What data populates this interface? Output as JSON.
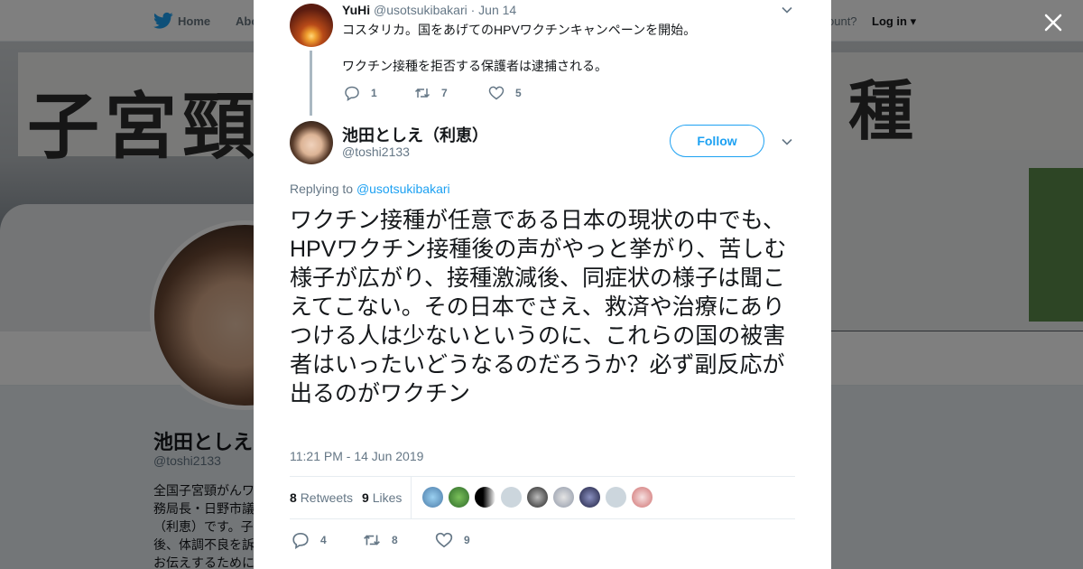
{
  "background": {
    "nav": {
      "home": "Home",
      "about": "Abo",
      "account_prompt": "ccount?",
      "login": "Log in"
    },
    "banner": {
      "sign_left": "子宮頸",
      "sign_right": "種"
    },
    "profile": {
      "name": "池田としえ",
      "handle": "@toshi2133",
      "bio": "全国子宮頸がんワ務局長・日野市議（利恵）です。子後、体調不良を訴お伝えするために"
    }
  },
  "modal": {
    "parent_tweet": {
      "name": "YuHi",
      "handle": "@usotsukibakari",
      "date": "· Jun 14",
      "line1": "コスタリカ。国をあげてのHPVワクチンキャンペーンを開始。",
      "line2": "ワクチン接種を拒否する保護者は逮捕される。",
      "replies": "1",
      "retweets": "7",
      "likes": "5"
    },
    "tweet": {
      "name": "池田としえ（利恵）",
      "handle": "@toshi2133",
      "follow_label": "Follow",
      "replying_prefix": "Replying to",
      "replying_to": "@usotsukibakari",
      "text": "ワクチン接種が任意である日本の現状の中でも、HPVワクチン接種後の声がやっと挙がり、苦しむ様子が広がり、接種激減後、同症状の様子は聞こえてこない。その日本でさえ、救済や治療にありつける人は少ないというのに、これらの国の被害者はいったいどうなるのだろうか？必ず副反応が出るのがワクチン",
      "timestamp": "11:21 PM - 14 Jun 2019",
      "retweet_count": "8",
      "retweet_label": "Retweets",
      "like_count": "9",
      "like_label": "Likes",
      "replies": "4",
      "retweets": "8",
      "likes": "9"
    }
  },
  "colors": {
    "accent": "#1da1f2",
    "muted": "#657786",
    "text": "#14171a"
  },
  "icons": [
    "twitter-bird-icon",
    "close-icon",
    "chevron-down-icon",
    "reply-icon",
    "retweet-icon",
    "heart-icon"
  ]
}
